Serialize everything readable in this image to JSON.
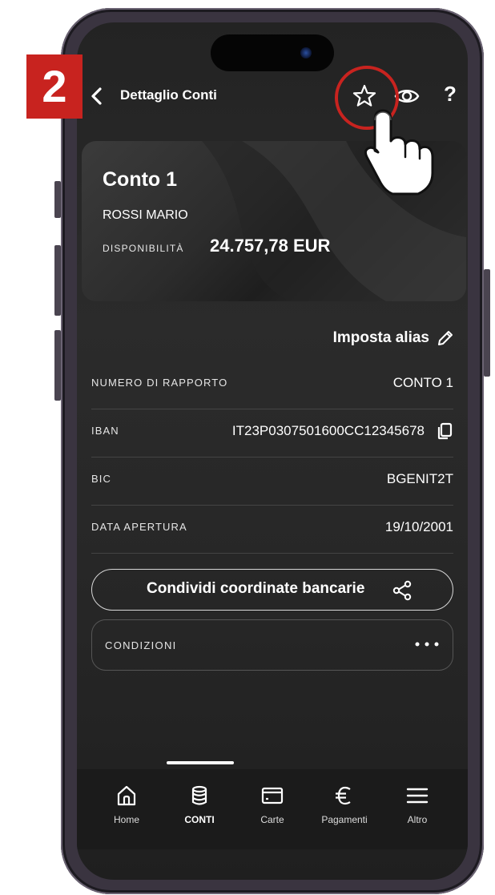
{
  "overlay": {
    "step_number": "2",
    "accent": "#c8231f"
  },
  "header": {
    "title": "Dettaglio Conti",
    "icons": [
      "back-icon",
      "star-icon",
      "eye-icon",
      "help-icon"
    ],
    "help_glyph": "?"
  },
  "card": {
    "account_name": "Conto 1",
    "holder": "ROSSI MARIO",
    "availability_label": "DISPONIBILITÀ",
    "availability_value": "24.757,78 EUR"
  },
  "alias": {
    "label": "Imposta alias"
  },
  "details": [
    {
      "label": "NUMERO DI RAPPORTO",
      "value": "CONTO 1"
    },
    {
      "label": "IBAN",
      "value": "IT23P0307501600CC12345678"
    },
    {
      "label": "BIC",
      "value": "BGENIT2T"
    },
    {
      "label": "DATA APERTURA",
      "value": "19/10/2001"
    }
  ],
  "actions": {
    "share_label": "Condividi coordinate bancarie",
    "conditions_label": "CONDIZIONI"
  },
  "nav": {
    "items": [
      {
        "label": "Home",
        "icon": "home-icon",
        "active": false
      },
      {
        "label": "CONTI",
        "icon": "database-icon",
        "active": true
      },
      {
        "label": "Carte",
        "icon": "card-icon",
        "active": false
      },
      {
        "label": "Pagamenti",
        "icon": "euro-icon",
        "active": false
      },
      {
        "label": "Altro",
        "icon": "menu-icon",
        "active": false
      }
    ]
  }
}
